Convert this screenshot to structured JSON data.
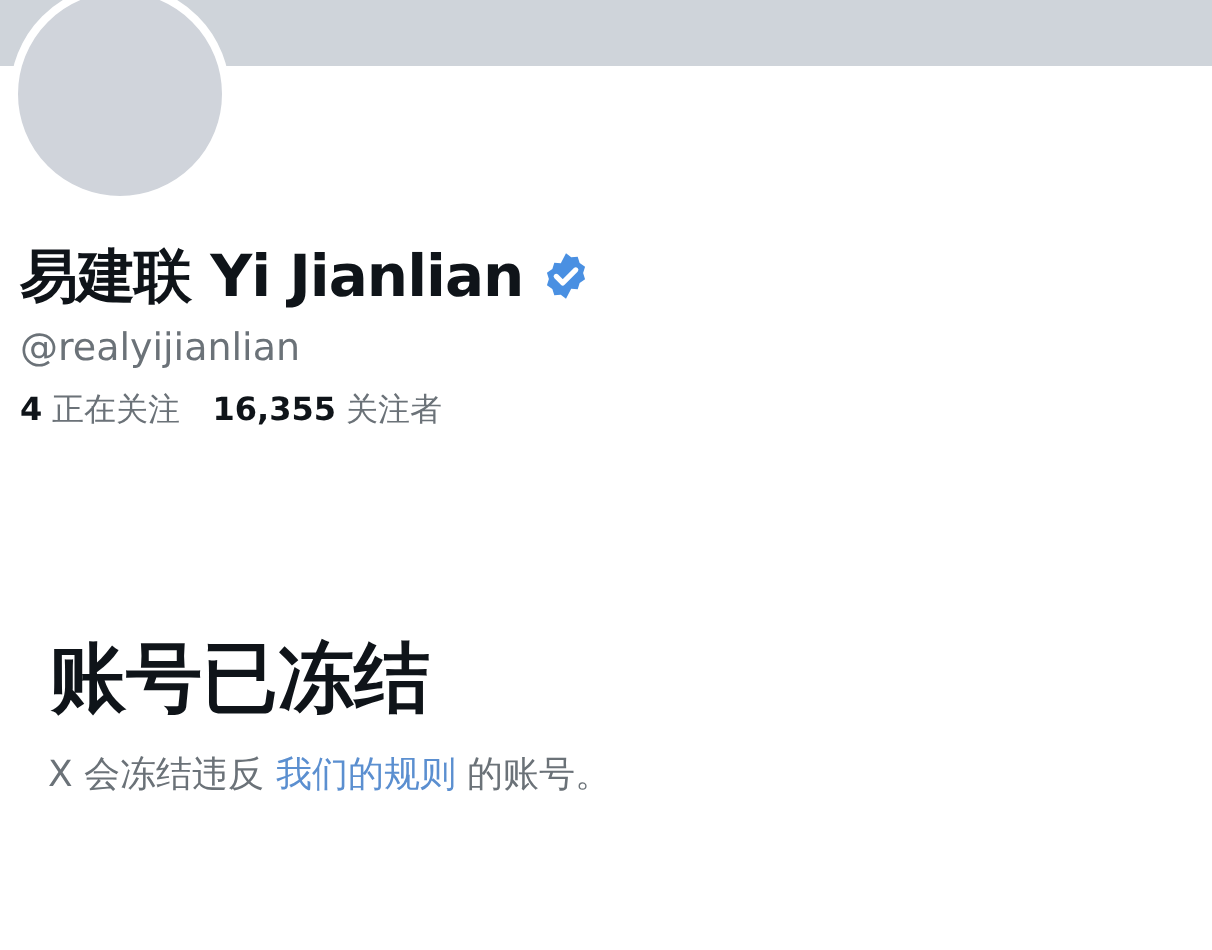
{
  "profile": {
    "name": "易建联 Yi Jianlian",
    "verified": true,
    "handle": "@realyijianlian",
    "stats": [
      {
        "count": "4",
        "label": "正在关注"
      },
      {
        "count": "16,355",
        "label": "关注者"
      }
    ]
  },
  "notice": {
    "title": "账号已冻结",
    "text_before": "X 会冻结违反 ",
    "link": "我们的规则",
    "text_after": " 的账号。"
  }
}
